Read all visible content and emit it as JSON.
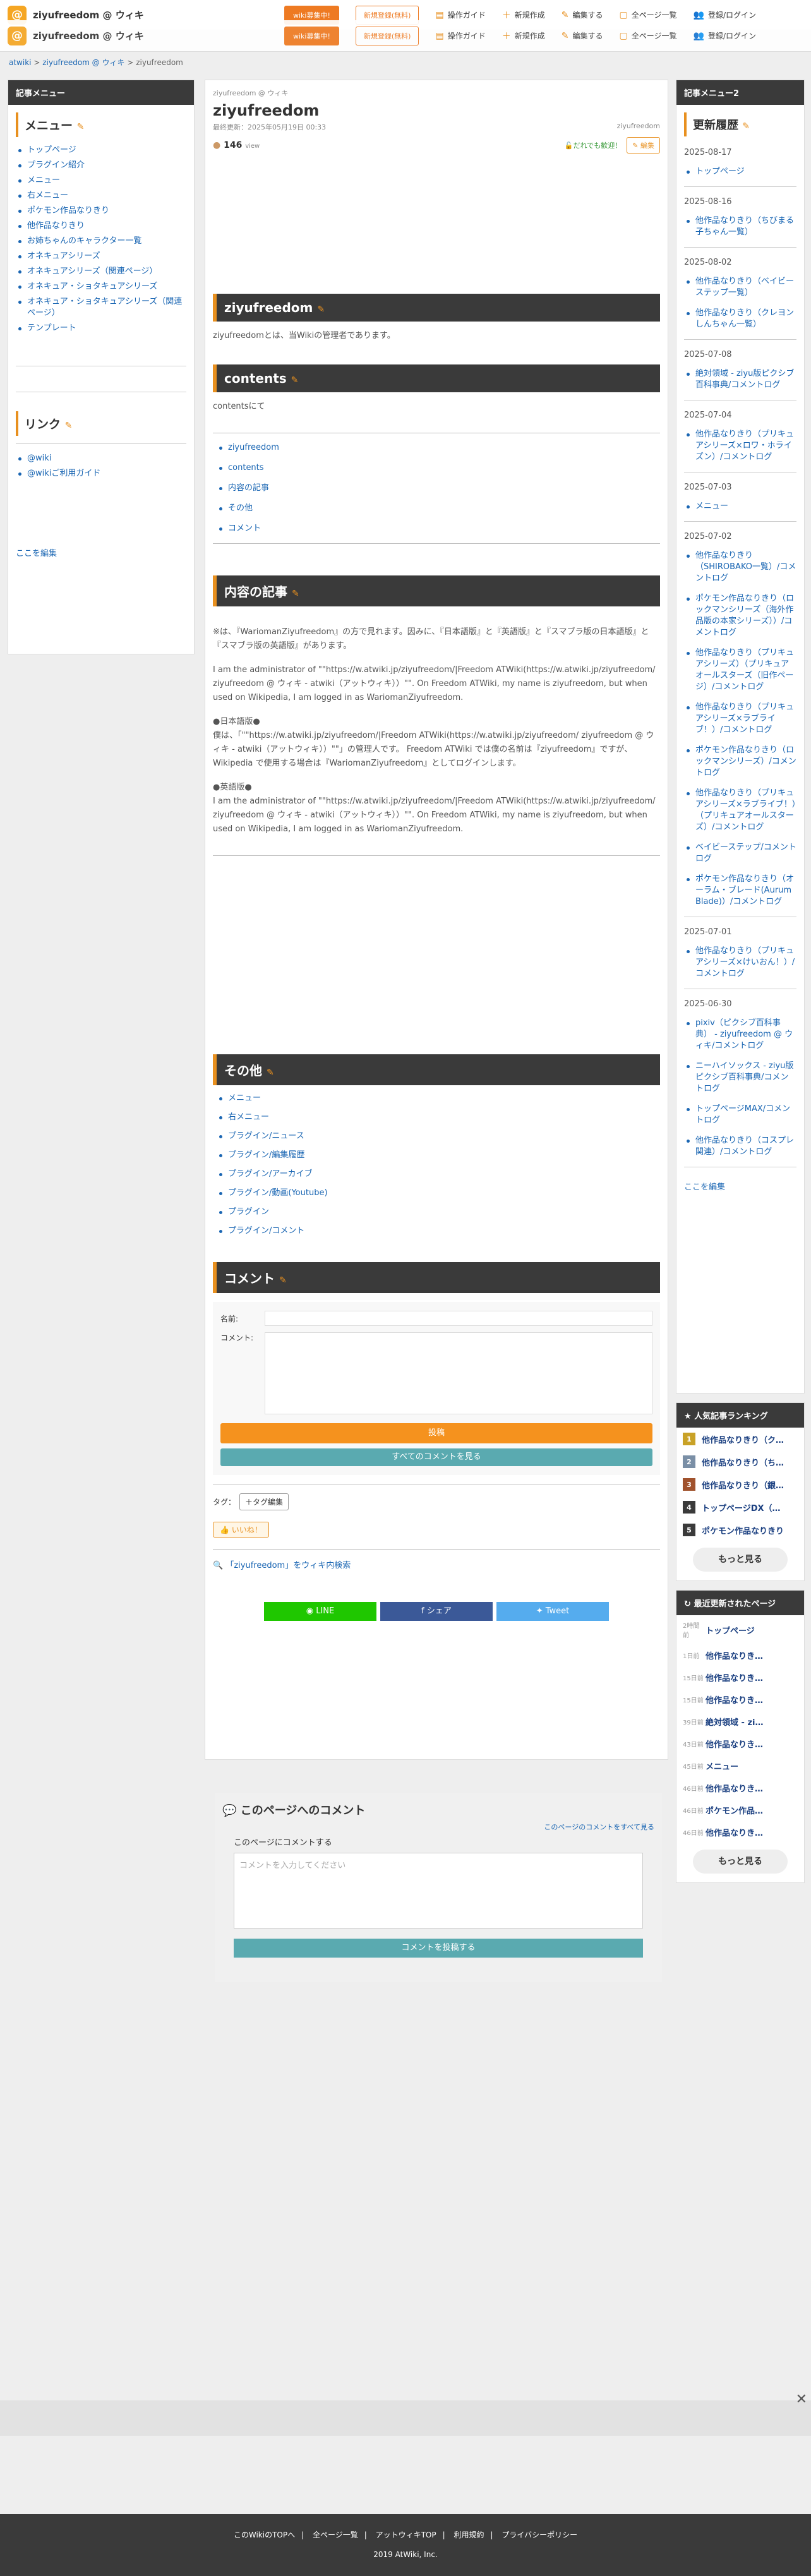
{
  "site": {
    "title": "ziyufreedom @ ウィキ",
    "logo": "@"
  },
  "topbar": {
    "recruit": "wiki募集中!",
    "signup": "新規登録(無料)",
    "nav": [
      "操作ガイド",
      "新規作成",
      "編集する",
      "全ページ一覧",
      "登録/ログイン"
    ]
  },
  "breadcrumb": [
    "atwiki",
    ">",
    "ziyufreedom @ ウィキ",
    ">",
    "ziyufreedom"
  ],
  "left": {
    "head": "記事メニュー",
    "menu_title": "メニュー",
    "menu": [
      "トップページ",
      "プラグイン紹介",
      "メニュー",
      "右メニュー",
      "ポケモン作品なりきり",
      "他作品なりきり",
      "お姉ちゃんのキャラクター一覧",
      "オネキュアシリーズ",
      "オネキュアシリーズ（関連ページ）",
      "オネキュア・ショタキュアシリーズ",
      "オネキュア・ショタキュアシリーズ（関連ページ）",
      "テンプレート"
    ],
    "link_title": "リンク",
    "links": [
      "@wiki",
      "@wikiご利用ガイド"
    ],
    "edit": "ここを編集"
  },
  "main": {
    "site_small": "ziyufreedom @ ウィキ",
    "page_title": "ziyufreedom",
    "updated": "最終更新：2025年05月19日 00:33",
    "author": "ziyufreedom",
    "views": "146",
    "views_unit": "view",
    "everyone": "だれでも歓迎！",
    "edit_btn": "編集",
    "h_ziyu": "ziyufreedom",
    "p_ziyu": "ziyufreedomとは、当Wikiの管理者であります。",
    "h_contents": "contents",
    "p_contents": "contentsにて",
    "toc": [
      "ziyufreedom",
      "contents",
      "内容の記事",
      "その他",
      "コメント"
    ],
    "h_naiyo": "内容の記事",
    "p1": "※は、『WariomanZiyufreedom』の方で見れます。因みに、『日本語版』と『英語版』と『スマブラ版の日本語版』と『スマブラ版の英語版』があります。",
    "p2": "I am the administrator of \"\"https://w.atwiki.jp/ziyufreedom/|Freedom ATWiki(https://w.atwiki.jp/ziyufreedom/ ziyufreedom @ ウィキ - atwiki（アットウィキ））\"\". On Freedom ATWiki, my name is ziyufreedom, but when used on Wikipedia, I am logged in as WariomanZiyufreedom.",
    "p3_head": "●日本語版●",
    "p3": "僕は、「\"\"https://w.atwiki.jp/ziyufreedom/|Freedom ATWiki(https://w.atwiki.jp/ziyufreedom/ ziyufreedom @ ウィキ - atwiki（アットウィキ））\"\"」の管理人です。 Freedom ATWiki では僕の名前は『ziyufreedom』ですが、Wikipedia で使用する場合は『WariomanZiyufreedom』としてログインします。",
    "p4_head": "●英語版●",
    "p4": "I am the administrator of \"\"https://w.atwiki.jp/ziyufreedom/|Freedom ATWiki(https://w.atwiki.jp/ziyufreedom/ ziyufreedom @ ウィキ - atwiki（アットウィキ））\"\". On Freedom ATWiki, my name is ziyufreedom, but when used on Wikipedia, I am logged in as WariomanZiyufreedom.",
    "h_sonota": "その他",
    "sonota": [
      "メニュー",
      "右メニュー",
      "プラグイン/ニュース",
      "プラグイン/編集履歴",
      "プラグイン/アーカイブ",
      "プラグイン/動画(Youtube)",
      "プラグイン",
      "プラグイン/コメント"
    ],
    "h_comment": "コメント",
    "name_label": "名前:",
    "comment_label": "コメント:",
    "post": "投稿",
    "see_all": "すべてのコメントを見る",
    "tag_label": "タグ：",
    "tag_edit": "＋タグ編集",
    "like": "いいね！",
    "search": "「ziyufreedom」をウィキ内検索",
    "share": [
      "LINE",
      "シェア",
      "Tweet"
    ],
    "pc_title": "このページへのコメント",
    "pc_all": "このページのコメントをすべて見る",
    "pc_label": "このページにコメントする",
    "pc_placeholder": "コメントを入力してください",
    "pc_submit": "コメントを投稿する"
  },
  "right": {
    "head": "記事メニュー2",
    "hist_title": "更新履歴",
    "history": [
      {
        "date": "2025-08-17",
        "items": [
          "トップページ"
        ]
      },
      {
        "date": "2025-08-16",
        "items": [
          "他作品なりきり（ちびまる子ちゃん一覧）"
        ]
      },
      {
        "date": "2025-08-02",
        "items": [
          "他作品なりきり（ベイビーステップ一覧）",
          "他作品なりきり（クレヨンしんちゃん一覧）"
        ]
      },
      {
        "date": "2025-07-08",
        "items": [
          "絶対領域 - ziyu版ピクシブ百科事典/コメントログ"
        ]
      },
      {
        "date": "2025-07-04",
        "items": [
          "他作品なりきり（プリキュアシリーズ×ロワ・ホライズン）/コメントログ"
        ]
      },
      {
        "date": "2025-07-03",
        "items": [
          "メニュー"
        ]
      },
      {
        "date": "2025-07-02",
        "items": [
          "他作品なりきり（SHIROBAKO一覧）/コメントログ",
          "ポケモン作品なりきり（ロックマンシリーズ（海外作品版の本家シリーズ））/コメントログ",
          "他作品なりきり（プリキュアシリーズ）（プリキュアオールスターズ（旧作ページ）/コメントログ",
          "他作品なりきり（プリキュアシリーズ×ラブライブ！）/コメントログ",
          "ポケモン作品なりきり（ロックマンシリーズ）/コメントログ",
          "他作品なりきり（プリキュアシリーズ×ラブライブ！）（プリキュアオールスターズ）/コメントログ",
          "ベイビーステップ/コメントログ",
          "ポケモン作品なりきり（オーラム・ブレード(Aurum Blade)）/コメントログ"
        ]
      },
      {
        "date": "2025-07-01",
        "items": [
          "他作品なりきり（プリキュアシリーズ×けいおん！）/コメントログ"
        ]
      },
      {
        "date": "2025-06-30",
        "items": [
          "pixiv（ピクシブ百科事典） - ziyufreedom @ ウィキ/コメントログ",
          "ニーハイソックス - ziyu版ピクシブ百科事典/コメントログ",
          "トップページMAX/コメントログ",
          "他作品なりきり（コスプレ関連）/コメントログ"
        ]
      }
    ],
    "edit": "ここを編集",
    "rank_title": "人気記事ランキング",
    "rank": [
      "他作品なりきり（ク…",
      "他作品なりきり（ち…",
      "他作品なりきり（銀…",
      "トップページDX（…",
      "ポケモン作品なりきり"
    ],
    "rank_colors": [
      "#c9a227",
      "#7a8fa6",
      "#a0522d",
      "#3a3a3a",
      "#3a3a3a"
    ],
    "more": "もっと見る",
    "recent_title": "最近更新されたページ",
    "recent": [
      {
        "t": "2時間前",
        "n": "トップページ"
      },
      {
        "t": "1日前",
        "n": "他作品なりき…"
      },
      {
        "t": "15日前",
        "n": "他作品なりき…"
      },
      {
        "t": "15日前",
        "n": "他作品なりき…"
      },
      {
        "t": "39日前",
        "n": "絶対領域 - zi…"
      },
      {
        "t": "43日前",
        "n": "他作品なりき…"
      },
      {
        "t": "45日前",
        "n": "メニュー"
      },
      {
        "t": "46日前",
        "n": "他作品なりき…"
      },
      {
        "t": "46日前",
        "n": "ポケモン作品…"
      },
      {
        "t": "46日前",
        "n": "他作品なりき…"
      }
    ]
  },
  "footer": {
    "links": [
      "このWikiのTOPへ",
      "全ページ一覧",
      "アットウィキTOP",
      "利用規約",
      "プライバシーポリシー"
    ],
    "copy": "2019 AtWiki, Inc."
  }
}
